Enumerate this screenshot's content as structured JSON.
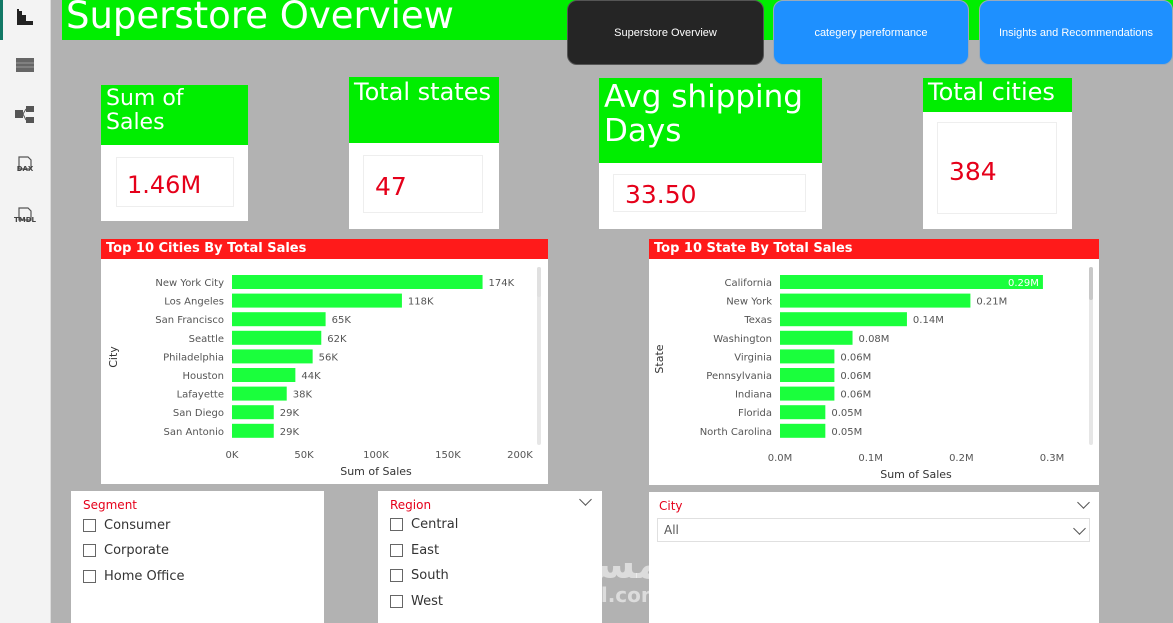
{
  "rail": {
    "icons": [
      "report-view-icon",
      "table-view-icon",
      "model-view-icon",
      "dax-query-icon",
      "tmdl-view-icon"
    ],
    "dax_label": "DAX",
    "tmdl_label": "TMDL"
  },
  "header": {
    "title": "Superstore Overview",
    "nav": [
      {
        "label": "Superstore Overview",
        "active": true
      },
      {
        "label": "categery pereformance",
        "active": false
      },
      {
        "label": "Insights and Recommendations",
        "active": false
      }
    ]
  },
  "kpis": {
    "sales": {
      "title": "Sum of Sales",
      "value": "1.46M"
    },
    "states": {
      "title": "Total states",
      "value": "47"
    },
    "shipping": {
      "title": "Avg shipping Days",
      "value": "33.50"
    },
    "cities": {
      "title": "Total cities",
      "value": "384"
    }
  },
  "colors": {
    "accent_green": "#00ee00",
    "bar_green": "#1aff3c",
    "header_red": "#ff1a1a",
    "value_red": "#e5001a",
    "nav_dark": "#252525",
    "nav_blue": "#1e90ff"
  },
  "chart_data": [
    {
      "type": "bar",
      "orientation": "horizontal",
      "title": "Top 10 Cities By Total Sales",
      "ylabel": "City",
      "xlabel": "Sum of Sales",
      "categories": [
        "New York City",
        "Los Angeles",
        "San Francisco",
        "Seattle",
        "Philadelphia",
        "Houston",
        "Lafayette",
        "San Diego",
        "San Antonio"
      ],
      "values": [
        174000,
        118000,
        65000,
        62000,
        56000,
        44000,
        38000,
        29000,
        29000
      ],
      "data_labels": [
        "174K",
        "118K",
        "65K",
        "62K",
        "56K",
        "44K",
        "38K",
        "29K",
        "29K"
      ],
      "xticks": [
        "0K",
        "50K",
        "100K",
        "150K",
        "200K"
      ],
      "xlim": [
        0,
        200000
      ]
    },
    {
      "type": "bar",
      "orientation": "horizontal",
      "title": "Top 10 State By Total Sales",
      "ylabel": "State",
      "xlabel": "Sum of Sales",
      "categories": [
        "California",
        "New York",
        "Texas",
        "Washington",
        "Virginia",
        "Pennsylvania",
        "Indiana",
        "Florida",
        "North Carolina"
      ],
      "values": [
        0.29,
        0.21,
        0.14,
        0.08,
        0.06,
        0.06,
        0.06,
        0.05,
        0.05
      ],
      "data_labels": [
        "0.29M",
        "0.21M",
        "0.14M",
        "0.08M",
        "0.06M",
        "0.06M",
        "0.06M",
        "0.05M",
        "0.05M"
      ],
      "xticks": [
        "0.0M",
        "0.1M",
        "0.2M",
        "0.3M"
      ],
      "xlim": [
        0,
        0.3
      ]
    }
  ],
  "slicers": {
    "segment": {
      "title": "Segment",
      "options": [
        "Consumer",
        "Corporate",
        "Home Office"
      ]
    },
    "region": {
      "title": "Region",
      "options": [
        "Central",
        "East",
        "South",
        "West"
      ]
    },
    "city": {
      "title": "City",
      "selected": "All"
    }
  },
  "watermark": {
    "arabic": "مستقل",
    "latin": "mostaql.com"
  }
}
